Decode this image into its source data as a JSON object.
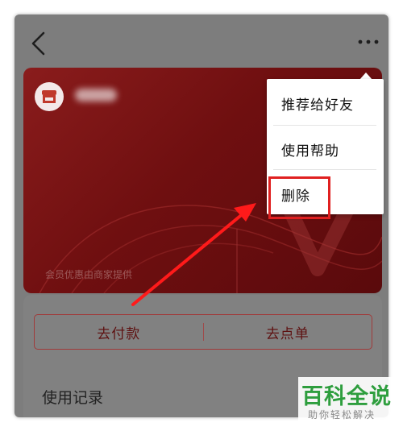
{
  "card": {
    "note": "会员优惠由商家提供"
  },
  "actions": {
    "pay_label": "去付款",
    "order_label": "去点单"
  },
  "records": {
    "title": "使用记录"
  },
  "menu": {
    "items": [
      {
        "label": "推荐给好友"
      },
      {
        "label": "使用帮助"
      },
      {
        "label": "删除"
      }
    ]
  },
  "watermark": {
    "title": "百科全说",
    "subtitle": "助你轻松解决"
  },
  "colors": {
    "card_red": "#7a1415",
    "highlight": "#e02020",
    "brand_green": "#2e9e3e"
  }
}
